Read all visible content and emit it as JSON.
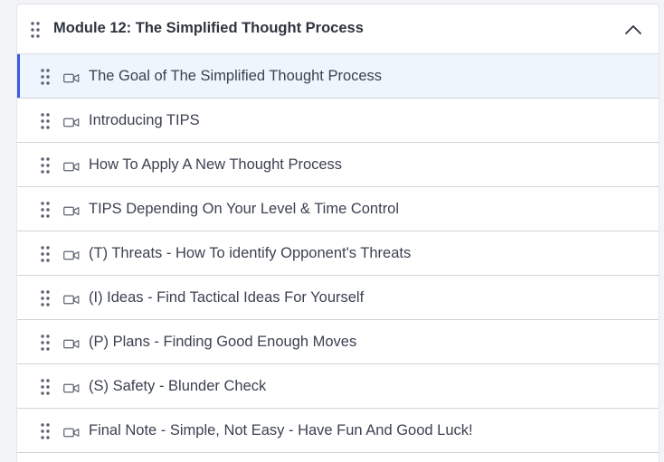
{
  "module": {
    "title": "Module 12: The Simplified Thought Process",
    "expanded": true,
    "toggle_icon": "chevron-up-icon",
    "drag_icon": "drag-handle-icon"
  },
  "lesson_icon": "video-camera-icon",
  "colors": {
    "active_background": "#eef5fd",
    "active_accent": "#3a5bd9",
    "text": "#3b4150",
    "title_text": "#2f3440",
    "divider": "#d0d4d9"
  },
  "lessons": [
    {
      "title": "The Goal of The Simplified Thought Process",
      "active": true
    },
    {
      "title": "Introducing TIPS",
      "active": false
    },
    {
      "title": "How To Apply A New Thought Process",
      "active": false
    },
    {
      "title": "TIPS Depending On Your Level & Time Control",
      "active": false
    },
    {
      "title": "(T) Threats - How To identify Opponent's Threats",
      "active": false
    },
    {
      "title": "(I) Ideas - Find Tactical Ideas For Yourself",
      "active": false
    },
    {
      "title": "(P) Plans - Finding Good Enough Moves",
      "active": false
    },
    {
      "title": "(S) Safety - Blunder Check",
      "active": false
    },
    {
      "title": "Final Note - Simple, Not Easy - Have Fun And Good Luck!",
      "active": false
    }
  ]
}
